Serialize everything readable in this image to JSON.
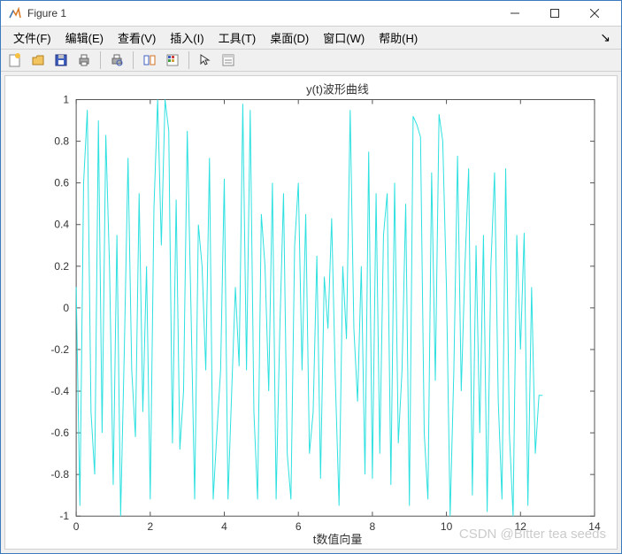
{
  "window": {
    "title": "Figure 1"
  },
  "menu": {
    "items": [
      "文件(F)",
      "编辑(E)",
      "查看(V)",
      "插入(I)",
      "工具(T)",
      "桌面(D)",
      "窗口(W)",
      "帮助(H)"
    ]
  },
  "toolbar": {
    "icons": [
      "new-figure-icon",
      "open-icon",
      "save-icon",
      "print-icon",
      "sep",
      "print-preview-icon",
      "sep",
      "link-icon",
      "colorbar-icon",
      "sep",
      "pointer-icon",
      "insert-icon"
    ]
  },
  "watermark": "CSDN @Bitter tea seeds",
  "chart_data": {
    "type": "line",
    "title": "y(t)波形曲线",
    "xlabel": "t数值向量",
    "ylabel": "",
    "xlim": [
      0,
      14
    ],
    "ylim": [
      -1,
      1
    ],
    "xticks": [
      0,
      2,
      4,
      6,
      8,
      10,
      12,
      14
    ],
    "yticks": [
      -1,
      -0.8,
      -0.6,
      -0.4,
      -0.2,
      0,
      0.2,
      0.4,
      0.6,
      0.8,
      1
    ],
    "line_color": "#2ee0e0",
    "series": [
      {
        "name": "y(t)",
        "x": [
          0,
          0.1,
          0.2,
          0.3,
          0.4,
          0.5,
          0.6,
          0.7,
          0.8,
          0.9,
          1.0,
          1.1,
          1.2,
          1.3,
          1.4,
          1.5,
          1.6,
          1.7,
          1.8,
          1.9,
          2.0,
          2.1,
          2.2,
          2.3,
          2.4,
          2.5,
          2.6,
          2.7,
          2.8,
          2.9,
          3.0,
          3.1,
          3.2,
          3.3,
          3.4,
          3.5,
          3.6,
          3.7,
          3.8,
          3.9,
          4.0,
          4.1,
          4.2,
          4.3,
          4.4,
          4.5,
          4.6,
          4.7,
          4.8,
          4.9,
          5.0,
          5.1,
          5.2,
          5.3,
          5.4,
          5.5,
          5.6,
          5.7,
          5.8,
          5.9,
          6.0,
          6.1,
          6.2,
          6.3,
          6.4,
          6.5,
          6.6,
          6.7,
          6.8,
          6.9,
          7.0,
          7.1,
          7.2,
          7.3,
          7.4,
          7.5,
          7.6,
          7.7,
          7.8,
          7.9,
          8.0,
          8.1,
          8.2,
          8.3,
          8.4,
          8.5,
          8.6,
          8.7,
          8.8,
          8.9,
          9.0,
          9.1,
          9.2,
          9.3,
          9.4,
          9.5,
          9.6,
          9.7,
          9.8,
          9.9,
          10.0,
          10.1,
          10.2,
          10.3,
          10.4,
          10.5,
          10.6,
          10.7,
          10.8,
          10.9,
          11.0,
          11.1,
          11.2,
          11.3,
          11.4,
          11.5,
          11.6,
          11.7,
          11.8,
          11.9,
          12.0,
          12.1,
          12.2,
          12.3,
          12.4,
          12.5,
          12.6
        ],
        "y": [
          0.1,
          -0.95,
          0.6,
          0.95,
          -0.5,
          -0.8,
          0.9,
          -0.6,
          0.83,
          0.2,
          -0.85,
          0.35,
          -1.0,
          -0.2,
          0.72,
          -0.3,
          -0.62,
          0.55,
          -0.5,
          0.2,
          -0.92,
          0.48,
          1.0,
          0.3,
          1.0,
          0.85,
          -0.65,
          0.52,
          -0.68,
          -0.4,
          0.85,
          0.0,
          -0.92,
          0.4,
          0.2,
          -0.3,
          0.72,
          -0.92,
          -0.6,
          -0.3,
          0.62,
          -0.92,
          -0.4,
          0.1,
          -0.28,
          0.98,
          -0.3,
          0.95,
          -0.5,
          -0.92,
          0.45,
          0.2,
          -0.4,
          0.6,
          -0.92,
          -0.1,
          0.55,
          -0.7,
          -0.92,
          0.3,
          0.6,
          -0.3,
          0.45,
          -0.7,
          -0.5,
          0.25,
          -0.82,
          0.15,
          -0.1,
          0.43,
          -0.35,
          -0.95,
          0.2,
          -0.15,
          0.95,
          -0.1,
          -0.45,
          0.2,
          -0.8,
          0.75,
          -0.82,
          0.55,
          -0.7,
          0.35,
          0.55,
          -0.85,
          0.6,
          -0.65,
          -0.3,
          0.5,
          -0.95,
          0.92,
          0.88,
          0.82,
          -0.6,
          -0.92,
          0.65,
          -0.35,
          0.93,
          0.8,
          0.1,
          -1.0,
          -0.3,
          0.73,
          -0.4,
          0.2,
          0.67,
          -0.9,
          0.3,
          -0.6,
          0.35,
          -0.98,
          0.2,
          0.65,
          -0.45,
          -0.92,
          0.67,
          -0.6,
          -1.0,
          0.35,
          -0.2,
          0.36,
          -0.95,
          0.1,
          -0.7,
          -0.42,
          -0.42
        ]
      }
    ]
  }
}
